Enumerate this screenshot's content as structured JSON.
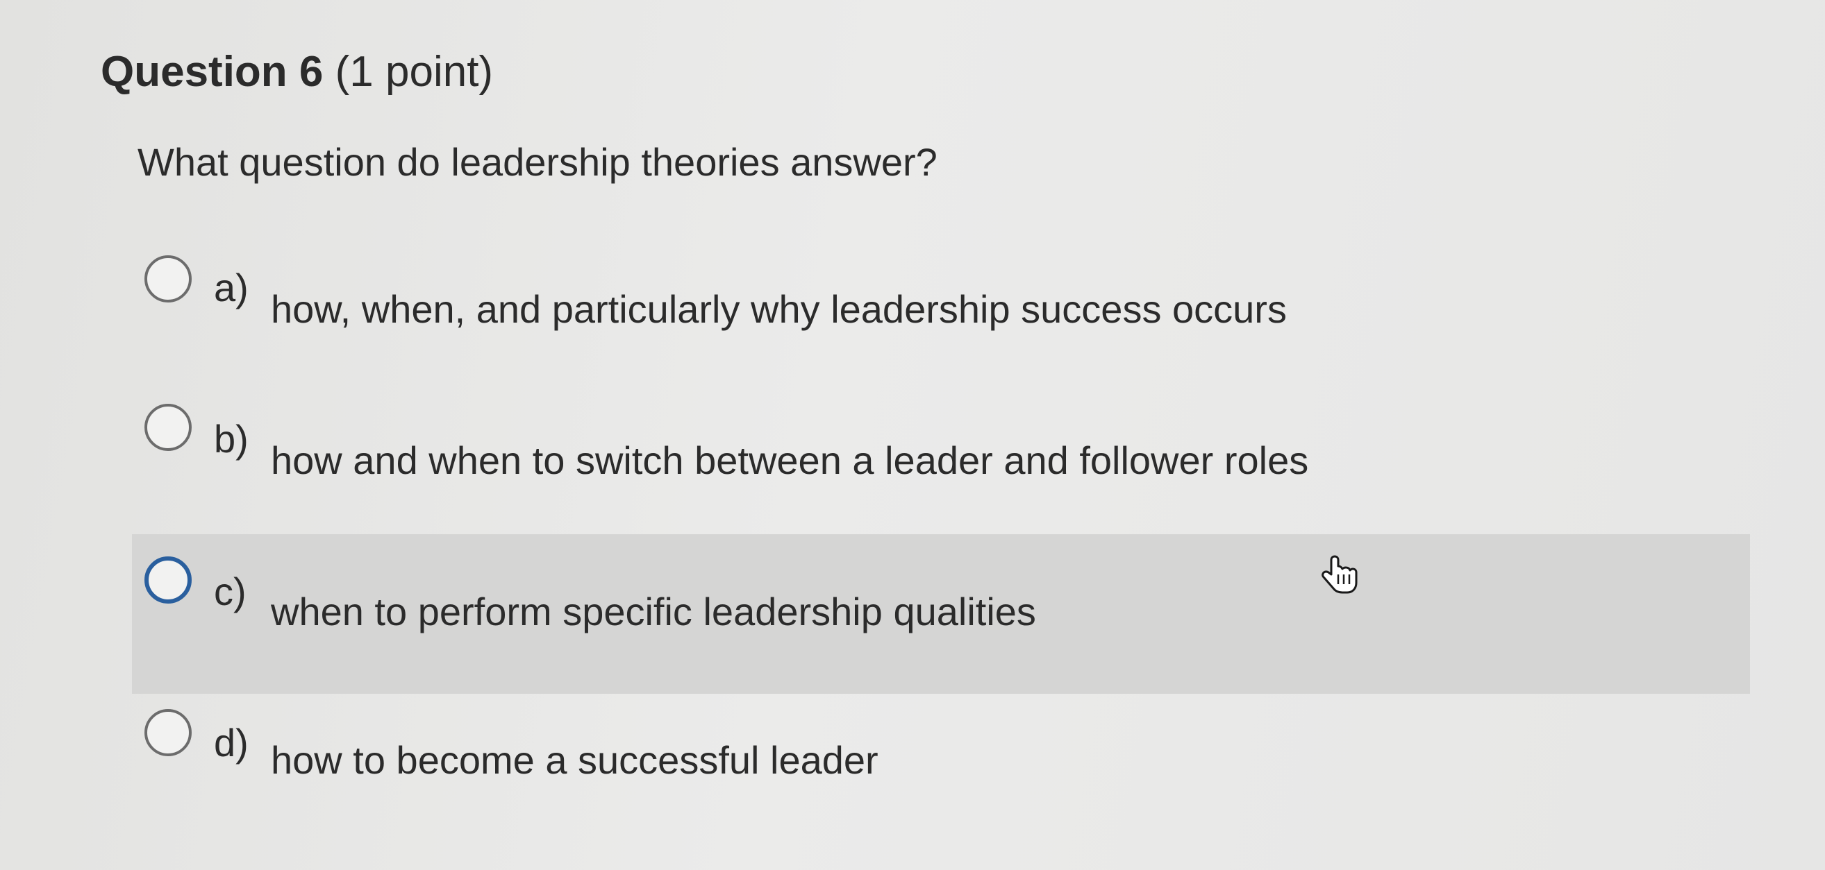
{
  "question": {
    "title": "Question 6",
    "points": "(1 point)",
    "prompt": "What question do leadership theories answer?"
  },
  "options": [
    {
      "letter": "a)",
      "text": "how, when, and particularly why leadership success occurs",
      "selected": false,
      "hovered": false
    },
    {
      "letter": "b)",
      "text": "how and when to switch between a leader and follower roles",
      "selected": false,
      "hovered": false
    },
    {
      "letter": "c)",
      "text": "when to perform specific leadership qualities",
      "selected": false,
      "hovered": true
    },
    {
      "letter": "d)",
      "text": "how to become a successful leader",
      "selected": false,
      "hovered": false
    }
  ],
  "icons": {
    "radio": "radio-button-icon",
    "cursor": "hand-pointer-cursor-icon"
  },
  "colors": {
    "text": "#2b2b2b",
    "hover_background": "#d5d5d4",
    "focus_ring": "#2a5f9e",
    "radio_border": "#6c6c6c"
  }
}
